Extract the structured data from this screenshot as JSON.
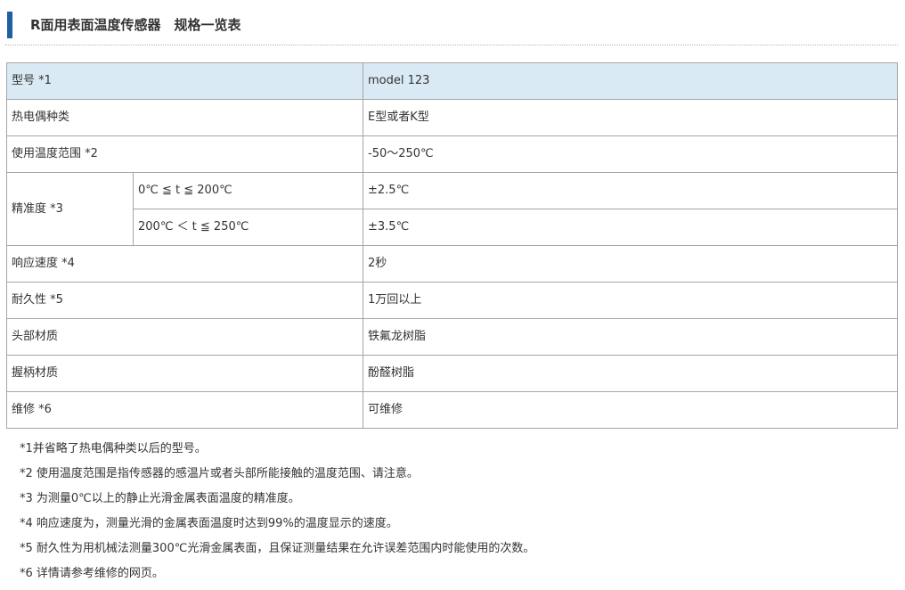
{
  "header": {
    "title": "R面用表面温度传感器　规格一览表",
    "accent_color": "#1f5fa0"
  },
  "table": {
    "header_fill": "#daeaf4",
    "model": {
      "label": "型号 *1",
      "value": "model 123"
    },
    "thermocouple": {
      "label": "热电偶种类",
      "value": "E型或者K型"
    },
    "temp_range": {
      "label": "使用温度范围 *2",
      "value": "-50～250℃"
    },
    "accuracy": {
      "label": "精准度 *3",
      "ranges": [
        {
          "condition": "0℃ ≦ t ≦ 200℃",
          "value": "±2.5℃"
        },
        {
          "condition": "200℃ ＜ t ≦ 250℃",
          "value": "±3.5℃"
        }
      ]
    },
    "response": {
      "label": "响应速度 *4",
      "value": "2秒"
    },
    "durability": {
      "label": "耐久性 *5",
      "value": "1万回以上"
    },
    "head_material": {
      "label": "头部材质",
      "value": "铁氟龙树脂"
    },
    "grip_material": {
      "label": "握柄材质",
      "value": "酚醛树脂"
    },
    "repair": {
      "label": "维修 *6",
      "value": "可维修"
    }
  },
  "notes": [
    "*1并省略了热电偶种类以后的型号。",
    "*2 使用温度范围是指传感器的感温片或者头部所能接触的温度范围、请注意。",
    "*3 为测量0℃以上的静止光滑金属表面温度的精准度。",
    "*4 响应速度为，测量光滑的金属表面温度时达到99%的温度显示的速度。",
    "*5 耐久性为用机械法测量300℃光滑金属表面，且保证测量结果在允许误差范围内时能使用的次数。",
    "*6 详情请参考维修的网页。"
  ]
}
